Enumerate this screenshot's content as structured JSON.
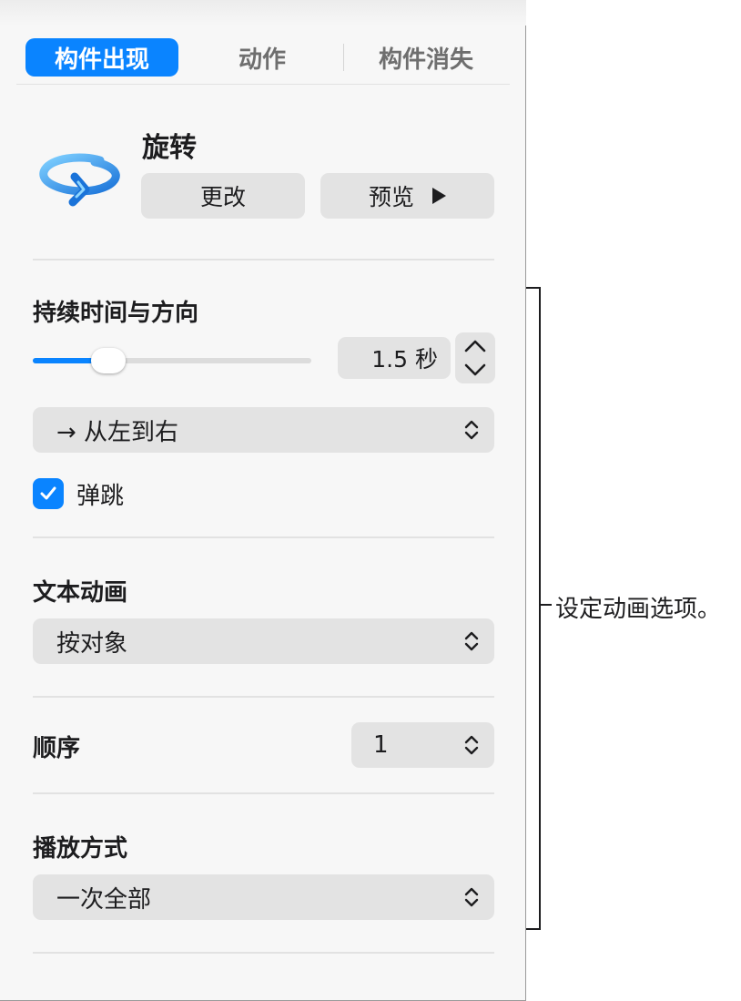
{
  "tabs": [
    {
      "label": "构件出现",
      "active": true
    },
    {
      "label": "动作",
      "active": false
    },
    {
      "label": "构件消失",
      "active": false
    }
  ],
  "effect": {
    "icon": "rotate-arrow-icon",
    "name": "旋转",
    "change_label": "更改",
    "preview_label": "预览"
  },
  "duration": {
    "title": "持续时间与方向",
    "slider_fraction": 0.27,
    "value": "1.5 秒",
    "direction": "→ 从左到右",
    "bounce_label": "弹跳",
    "bounce_checked": true
  },
  "text_animation": {
    "title": "文本动画",
    "value": "按对象"
  },
  "order": {
    "title": "顺序",
    "value": "1"
  },
  "playback": {
    "title": "播放方式",
    "value": "一次全部"
  },
  "callout": {
    "text": "设定动画选项。"
  },
  "colors": {
    "accent": "#0a84ff",
    "panel_bg": "#f7f7f7",
    "control_bg": "#e3e3e3"
  }
}
